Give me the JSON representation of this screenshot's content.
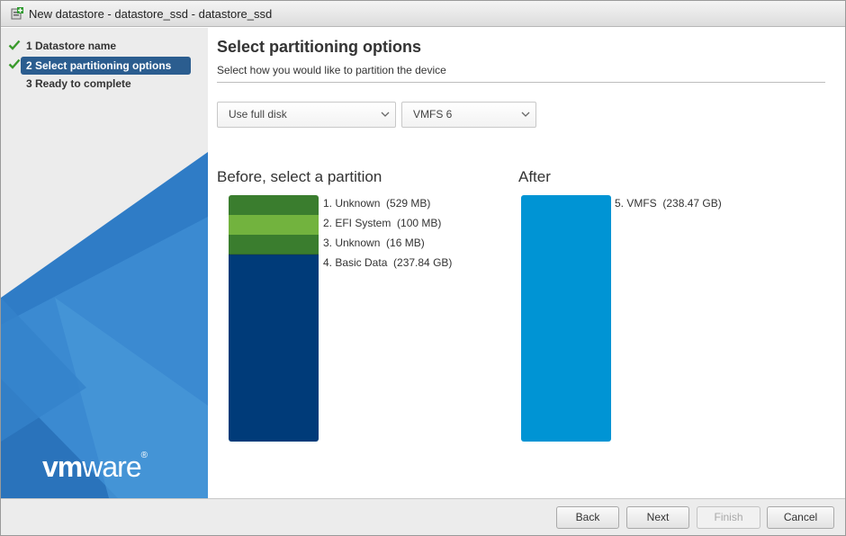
{
  "window": {
    "title": "New datastore - datastore_ssd - datastore_ssd"
  },
  "sidebar": {
    "steps": [
      {
        "label": "1 Datastore name",
        "completed": true,
        "active": false
      },
      {
        "label": "2 Select partitioning options",
        "completed": true,
        "active": true
      },
      {
        "label": "3 Ready to complete",
        "completed": false,
        "active": false
      }
    ],
    "logo": "vmware"
  },
  "main": {
    "title": "Select partitioning options",
    "subtitle": "Select how you would like to partition the device",
    "partition_scheme": {
      "selected": "Use full disk"
    },
    "filesystem": {
      "selected": "VMFS 6"
    },
    "before": {
      "heading": "Before, select a partition",
      "partitions": [
        {
          "label": "1. Unknown  (529 MB)",
          "color": "#3a7d2e"
        },
        {
          "label": "2. EFI System  (100 MB)",
          "color": "#72b33e"
        },
        {
          "label": "3. Unknown  (16 MB)",
          "color": "#3a7d2e"
        },
        {
          "label": "4. Basic Data  (237.84 GB)",
          "color": "#003b79"
        }
      ]
    },
    "after": {
      "heading": "After",
      "partitions": [
        {
          "label": "5. VMFS  (238.47 GB)",
          "color": "#0094d4"
        }
      ]
    }
  },
  "footer": {
    "back": "Back",
    "next": "Next",
    "finish": "Finish",
    "cancel": "Cancel",
    "finish_enabled": false
  },
  "colors": {
    "accent": "#2b5d8f",
    "check": "#3a9a2c"
  }
}
